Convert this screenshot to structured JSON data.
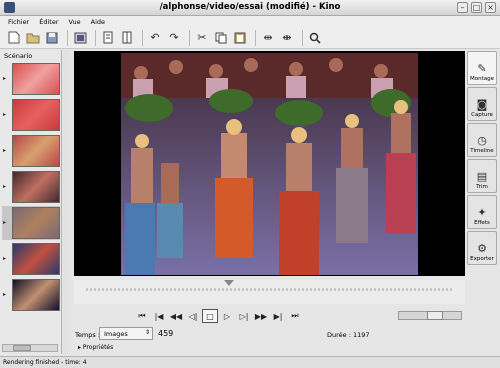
{
  "window": {
    "title": "/alphonse/video/essai (modifié) - Kino"
  },
  "menu": [
    "Fichier",
    "Éditer",
    "Vue",
    "Aide"
  ],
  "toolbar": {
    "buttons": [
      "new-file-icon",
      "open-folder-icon",
      "save-icon",
      "export-icon",
      "cut-scene-icon",
      "split-scene-icon",
      "undo-icon",
      "redo-icon",
      "cut-icon",
      "copy-icon",
      "paste-icon",
      "split-icon",
      "join-icon",
      "zoom-icon"
    ]
  },
  "sidebar": {
    "label": "Scénario",
    "scene_count": 7,
    "selected_index": 4
  },
  "right_tabs": [
    "Montage",
    "Capture",
    "Timeline",
    "Trim",
    "Effets",
    "Exporter"
  ],
  "transport": [
    "start-icon",
    "prev-scene-icon",
    "prev-frame-icon",
    "rewind-icon",
    "stop-icon",
    "play-icon",
    "next-frame-icon",
    "forward-icon",
    "next-scene-icon",
    "end-icon"
  ],
  "controls": {
    "temps_label": "Temps :",
    "mode_value": "Images",
    "frame_number": "459",
    "duree": "Durée : 1197",
    "properties": "Propriétés"
  },
  "shuttle_position": 0.6,
  "status": "Rendering finished - time: 4",
  "colors": {
    "background": "#e6e6e6",
    "video_bg": "#000000"
  }
}
